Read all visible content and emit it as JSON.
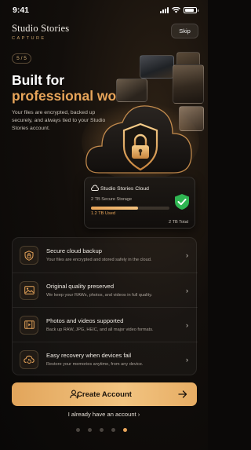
{
  "status_bar": {
    "time": "9:41"
  },
  "brand": {
    "name": "Studio Stories",
    "sub": "CAPTURE"
  },
  "header": {
    "skip_label": "Skip",
    "step": "5 / 5"
  },
  "hero": {
    "title_line1": "Built for",
    "title_line2": "professional work.",
    "description": "Your files are encrypted, backed up securely, and always tied to your Studio Stories account."
  },
  "storage_card": {
    "title": "Studio Stories Cloud",
    "capacity": "2 TB Secure Storage",
    "used": "1.2 TB Used",
    "total": "2 TB Total",
    "used_fraction": 0.6
  },
  "features": [
    {
      "title": "Secure cloud backup",
      "subtitle": "Your files are encrypted and stored safely in the cloud.",
      "icon": "lock-icon"
    },
    {
      "title": "Original quality preserved",
      "subtitle": "We keep your RAWs, photos, and videos in full quality.",
      "icon": "image-icon"
    },
    {
      "title": "Photos and videos supported",
      "subtitle": "Back up RAW, JPG, HEIC, and all major video formats.",
      "icon": "film-icon"
    },
    {
      "title": "Easy recovery when devices fail",
      "subtitle": "Restore your memories anytime, from any device.",
      "icon": "cloud-restore-icon"
    }
  ],
  "cta": {
    "label": "Create Account"
  },
  "signin": {
    "label": "I already have an account  ›"
  },
  "pager": {
    "count": 5,
    "active": 5
  },
  "colors": {
    "accent": "#e8a55a",
    "success": "#2fb552",
    "background": "#0b0908"
  }
}
